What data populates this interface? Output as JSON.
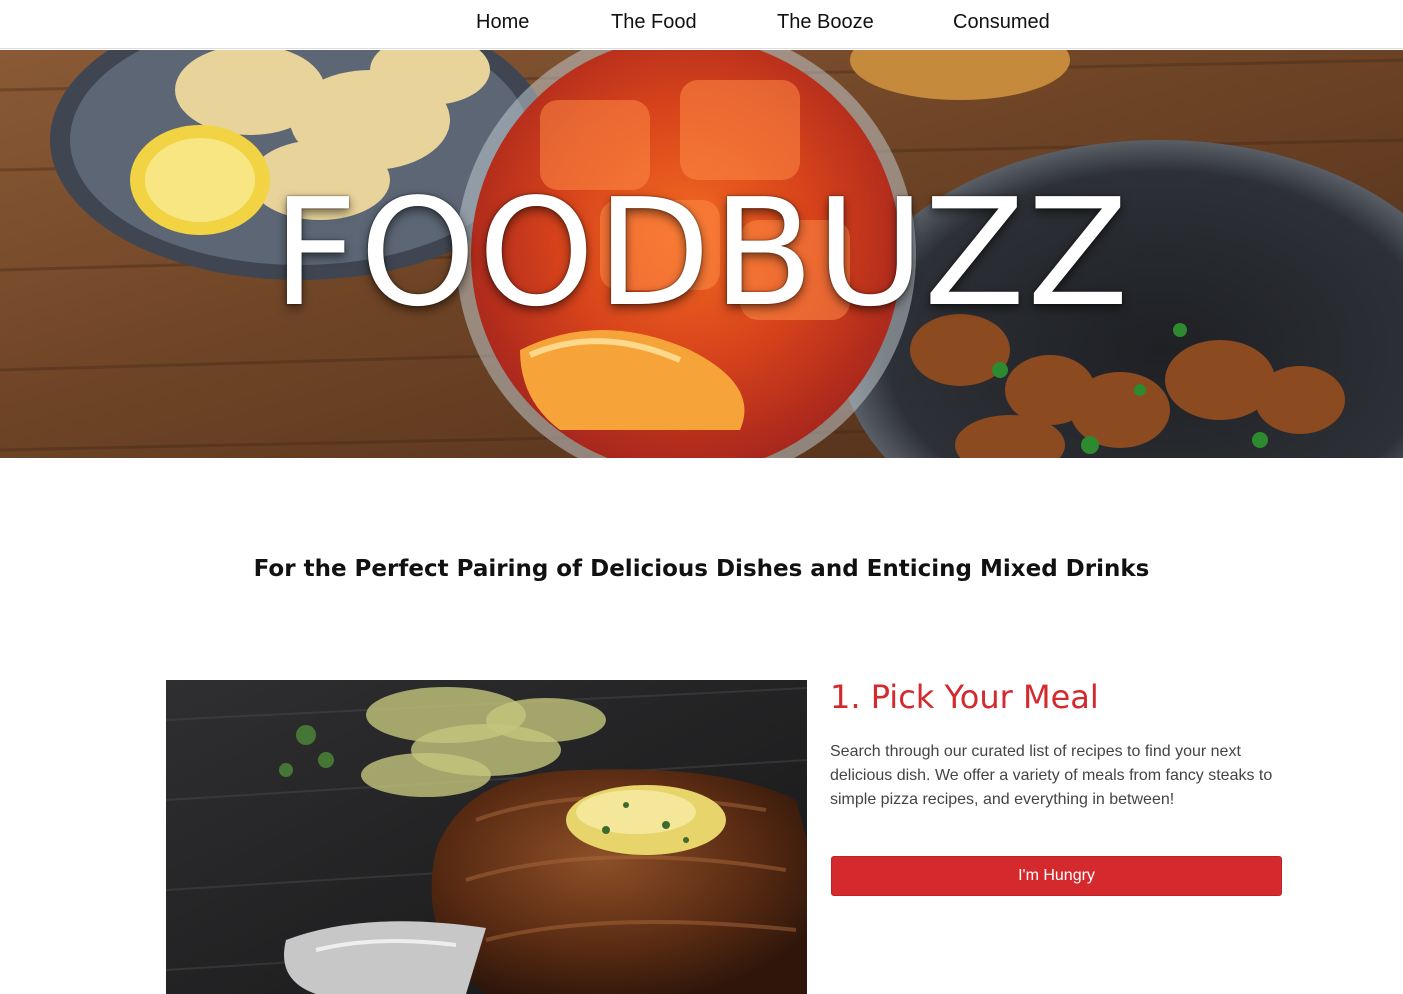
{
  "nav": {
    "items": [
      {
        "label": "Home"
      },
      {
        "label": "The Food"
      },
      {
        "label": "The Booze"
      },
      {
        "label": "Consumed"
      }
    ]
  },
  "hero": {
    "title": "FOODBUZZ"
  },
  "tagline": "For the Perfect Pairing of Delicious Dishes and Enticing Mixed Drinks",
  "feature": {
    "heading": "1. Pick Your Meal",
    "text": "Search through our curated list of recipes to find your next delicious dish. We offer a variety of meals from fancy steaks to simple pizza recipes, and everything in between!",
    "button_label": "I'm Hungry"
  },
  "colors": {
    "accent": "#d42a2e",
    "text": "#111111",
    "muted_text": "#444444"
  }
}
